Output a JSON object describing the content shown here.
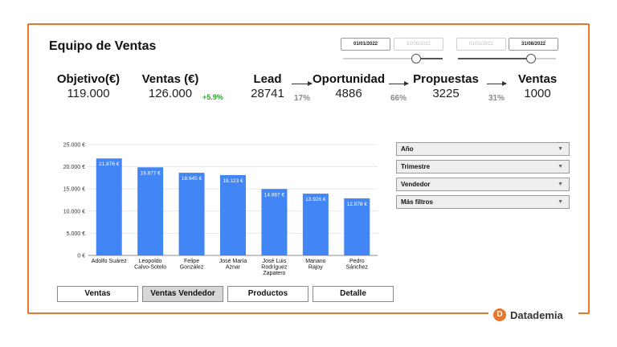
{
  "header": {
    "title": "Equipo de Ventas"
  },
  "date_range_1": {
    "start": "01/01/2022",
    "end": "31/08/2022"
  },
  "date_range_2": {
    "start": "01/01/2022",
    "end": "31/08/2022"
  },
  "kpis": {
    "objetivo": {
      "label": "Objetivo(€)",
      "value": "119.000"
    },
    "ventas": {
      "label": "Ventas (€)",
      "value": "126.000",
      "delta": "+5.9%"
    }
  },
  "funnel": {
    "lead": {
      "label": "Lead",
      "value": "28741"
    },
    "oportunidad": {
      "label": "Oportunidad",
      "value": "4886"
    },
    "propuestas": {
      "label": "Propuestas",
      "value": "3225"
    },
    "ventas": {
      "label": "Ventas",
      "value": "1000"
    },
    "conv_1": "17%",
    "conv_2": "66%",
    "conv_3": "31%"
  },
  "chart_data": {
    "type": "bar",
    "categories": [
      [
        "Adolfo Suárez"
      ],
      [
        "Leopoldo",
        "Calvo-Sotelo"
      ],
      [
        "Felipe",
        "González"
      ],
      [
        "José María",
        "Aznar"
      ],
      [
        "José Luis",
        "Rodríguez",
        "Zapatero"
      ],
      [
        "Mariano",
        "Rajoy"
      ],
      [
        "Pedro",
        "Sánchez"
      ]
    ],
    "values": [
      21876,
      19877,
      18645,
      18123,
      14987,
      13926,
      12878
    ],
    "data_labels": [
      "21.876 €",
      "19.877 €",
      "18.645 €",
      "18.123 €",
      "14.987 €",
      "13.926 €",
      "12.878 €"
    ],
    "yticks": [
      0,
      5000,
      10000,
      15000,
      20000,
      25000
    ],
    "ytick_labels": [
      "0 €",
      "5.000 €",
      "10.000 €",
      "15.000 €",
      "20.000 €",
      "25.000 €"
    ],
    "ylim": [
      0,
      25000
    ],
    "grid": true,
    "bar_color": "#4285f4",
    "title": "",
    "xlabel": "",
    "ylabel": ""
  },
  "filters": [
    {
      "label": "Año"
    },
    {
      "label": "Trimestre"
    },
    {
      "label": "Vendedor"
    },
    {
      "label": "Más filtros"
    }
  ],
  "tabs": [
    {
      "label": "Ventas",
      "selected": false
    },
    {
      "label": "Ventas Vendedor",
      "selected": true
    },
    {
      "label": "Productos",
      "selected": false
    },
    {
      "label": "Detalle",
      "selected": false
    }
  ],
  "brand": {
    "logo_letter": "D",
    "name": "Datademia"
  },
  "colors": {
    "accent": "#e8762d",
    "positive": "#3a9c3a",
    "bar": "#4285f4"
  }
}
